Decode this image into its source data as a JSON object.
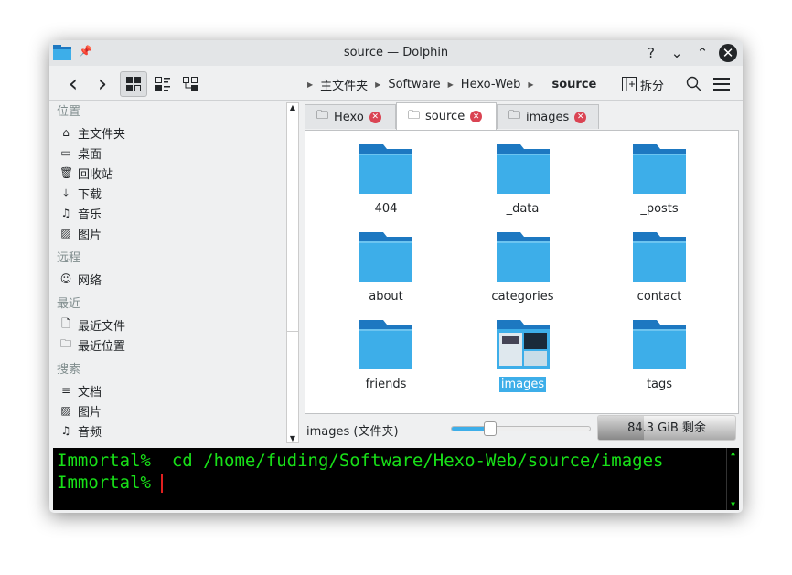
{
  "window": {
    "title": "source — Dolphin",
    "help": "?",
    "minimize": "⌄",
    "maximize": "⌃",
    "close": "✕"
  },
  "toolbar": {
    "back": "‹",
    "forward": "›",
    "split_label": "拆分"
  },
  "breadcrumb": [
    "主文件夹",
    "Software",
    "Hexo-Web",
    "source"
  ],
  "sidebar": {
    "sections": [
      {
        "title": "位置",
        "items": [
          {
            "label": "主文件夹",
            "icon": "home-icon"
          },
          {
            "label": "桌面",
            "icon": "desktop-icon"
          },
          {
            "label": "回收站",
            "icon": "trash-icon"
          },
          {
            "label": "下载",
            "icon": "download-icon"
          },
          {
            "label": "音乐",
            "icon": "music-icon"
          },
          {
            "label": "图片",
            "icon": "image-icon"
          }
        ]
      },
      {
        "title": "远程",
        "items": [
          {
            "label": "网络",
            "icon": "network-icon"
          }
        ]
      },
      {
        "title": "最近",
        "items": [
          {
            "label": "最近文件",
            "icon": "recent-files-icon"
          },
          {
            "label": "最近位置",
            "icon": "recent-locations-icon"
          }
        ]
      },
      {
        "title": "搜索",
        "items": [
          {
            "label": "文档",
            "icon": "document-icon"
          },
          {
            "label": "图片",
            "icon": "image-icon"
          },
          {
            "label": "音频",
            "icon": "music-icon"
          }
        ]
      }
    ]
  },
  "tabs": [
    {
      "label": "Hexo"
    },
    {
      "label": "source",
      "active": true
    },
    {
      "label": "images"
    }
  ],
  "files": [
    {
      "name": "404"
    },
    {
      "name": "_data"
    },
    {
      "name": "_posts"
    },
    {
      "name": "about"
    },
    {
      "name": "categories"
    },
    {
      "name": "contact"
    },
    {
      "name": "friends"
    },
    {
      "name": "images",
      "selected": true
    },
    {
      "name": "tags"
    }
  ],
  "status": {
    "selection": "images (文件夹)",
    "zoom_percent": 28,
    "free_space": "84.3 GiB 剩余",
    "disk_used_fraction": 0.33
  },
  "terminal": {
    "line1": "Immortal%  cd /home/fuding/Software/Hexo-Web/source/images",
    "line2": "Immortal% "
  },
  "colors": {
    "accent": "#3daee9",
    "folder": "#3daee9",
    "terminal_text": "#18e018",
    "close_tab": "#da4453"
  }
}
